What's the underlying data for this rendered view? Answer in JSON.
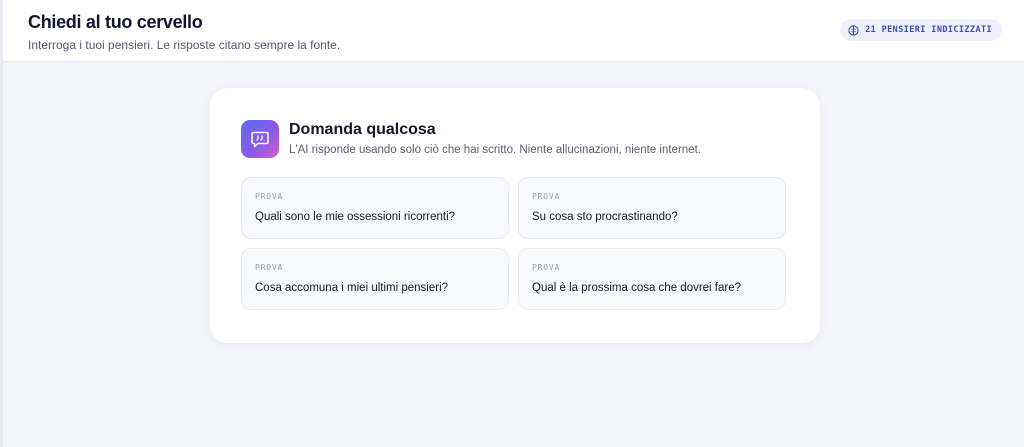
{
  "header": {
    "title": "Chiedi al tuo cervello",
    "subtitle": "Interroga i tuoi pensieri. Le risposte citano sempre la fonte.",
    "badge": {
      "text": "21 PENSIERI INDICIZZATI",
      "icon": "brain-icon",
      "color": "#3a4fb8"
    }
  },
  "card": {
    "icon": "chat-quote-icon",
    "title": "Domanda qualcosa",
    "subtitle": "L'AI risponde usando solo ciò che hai scritto. Niente allucinazioni, niente internet.",
    "accent_gradient": [
      "#5b6cf2",
      "#8a5ae8",
      "#d35bc6"
    ],
    "suggestions": [
      {
        "tag": "PROVA",
        "question": "Quali sono le mie ossessioni ricorrenti?"
      },
      {
        "tag": "PROVA",
        "question": "Su cosa sto procrastinando?"
      },
      {
        "tag": "PROVA",
        "question": "Cosa accomuna i miei ultimi pensieri?"
      },
      {
        "tag": "PROVA",
        "question": "Qual è la prossima cosa che dovrei fare?"
      }
    ]
  }
}
